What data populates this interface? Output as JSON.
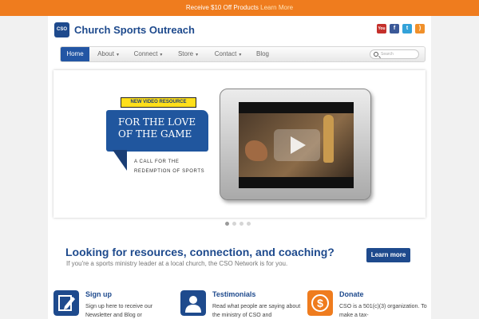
{
  "promo": {
    "text": "Receive $10 Off Products",
    "link": "Learn More"
  },
  "header": {
    "logo_text": "CSO",
    "title": "Church Sports Outreach",
    "social": [
      {
        "name": "youtube-icon",
        "label": "You"
      },
      {
        "name": "facebook-icon",
        "label": "f"
      },
      {
        "name": "twitter-icon",
        "label": "t"
      },
      {
        "name": "rss-icon",
        "label": ")"
      }
    ]
  },
  "nav": {
    "home": "Home",
    "about": "About",
    "connect": "Connect",
    "store": "Store",
    "contact": "Contact",
    "blog": "Blog",
    "search_placeholder": "Search"
  },
  "slider": {
    "badge": "NEW VIDEO RESOURCE",
    "headline": "FOR THE LOVE OF THE GAME",
    "caption": "A CALL FOR THE REDEMPTION OF SPORTS",
    "slide_count": 4,
    "active_slide": 1
  },
  "cta": {
    "heading": "Looking for resources, connection, and coaching?",
    "subtext": "If you're a sports ministry leader at a local church, the CSO Network is for you.",
    "button": "Learn more"
  },
  "features": {
    "signup": {
      "title": "Sign up",
      "text": "Sign up here to receive our Newsletter and Blog or"
    },
    "testimonials": {
      "title": "Testimonials",
      "text": "Read what people are saying about the ministry of CSO and"
    },
    "donate": {
      "title": "Donate",
      "text": "CSO is a 501(c)(3) organization. To make a tax-"
    }
  },
  "colors": {
    "brand_blue": "#1e4a8d",
    "promo_orange": "#ef7c1e",
    "donate_orange": "#ef7c1e"
  }
}
